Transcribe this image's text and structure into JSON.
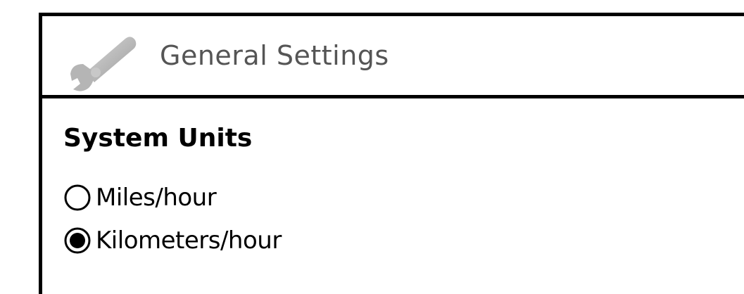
{
  "header": {
    "icon": "wrench-icon",
    "title": "General Settings"
  },
  "system_units": {
    "title": "System Units",
    "options": [
      {
        "label": "Miles/hour",
        "selected": false
      },
      {
        "label": "Kilometers/hour",
        "selected": true
      }
    ]
  }
}
